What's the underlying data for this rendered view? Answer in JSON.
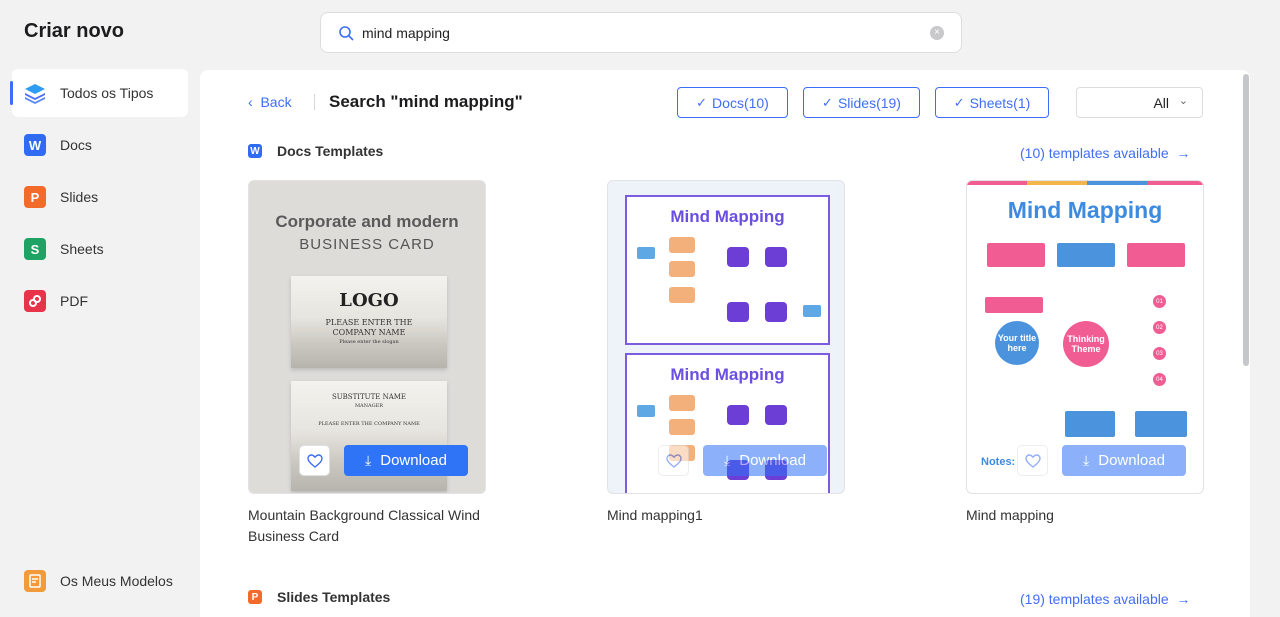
{
  "app_title": "Criar novo",
  "search": {
    "value": "mind mapping",
    "placeholder": ""
  },
  "sidebar": {
    "items": [
      {
        "label": "Todos os Tipos",
        "active": true
      },
      {
        "label": "Docs",
        "icon_letter": "W"
      },
      {
        "label": "Slides",
        "icon_letter": "P"
      },
      {
        "label": "Sheets",
        "icon_letter": "S"
      },
      {
        "label": "PDF"
      }
    ],
    "my_templates": "Os Meus Modelos"
  },
  "header": {
    "back": "Back",
    "title": "Search \"mind mapping\"",
    "filters": [
      "Docs(10)",
      "Slides(19)",
      "Sheets(1)"
    ],
    "select_value": "All"
  },
  "sections": {
    "docs": {
      "title": "Docs Templates",
      "available": "(10) templates available"
    },
    "slides": {
      "title": "Slides Templates",
      "available": "(19) templates available"
    }
  },
  "cards": [
    {
      "title": "Mountain Background Classical Wind Business Card",
      "thumb_heading": "Corporate and modern",
      "thumb_subheading": "BUSINESS CARD",
      "thumb_logo": "LOGO",
      "thumb_line1": "PLEASE ENTER THE",
      "thumb_line2": "COMPANY NAME",
      "thumb_line3": "Please enter the slogan",
      "thumb_name": "SUBSTITUTE NAME",
      "thumb_role": "MANAGER",
      "thumb_company": "PLEASE ENTER THE COMPANY NAME"
    },
    {
      "title": "Mind mapping1",
      "thumb_heading": "Mind Mapping"
    },
    {
      "title": "Mind mapping",
      "thumb_heading": "Mind Mapping",
      "thumb_center1": "Your title here",
      "thumb_center2": "Thinking Theme",
      "thumb_notes": "Notes:",
      "thumb_nums": [
        "01",
        "02",
        "03",
        "04"
      ]
    }
  ],
  "buttons": {
    "download": "Download"
  },
  "colors": {
    "accent": "#3f6ef6",
    "download": "#2f73f6"
  }
}
